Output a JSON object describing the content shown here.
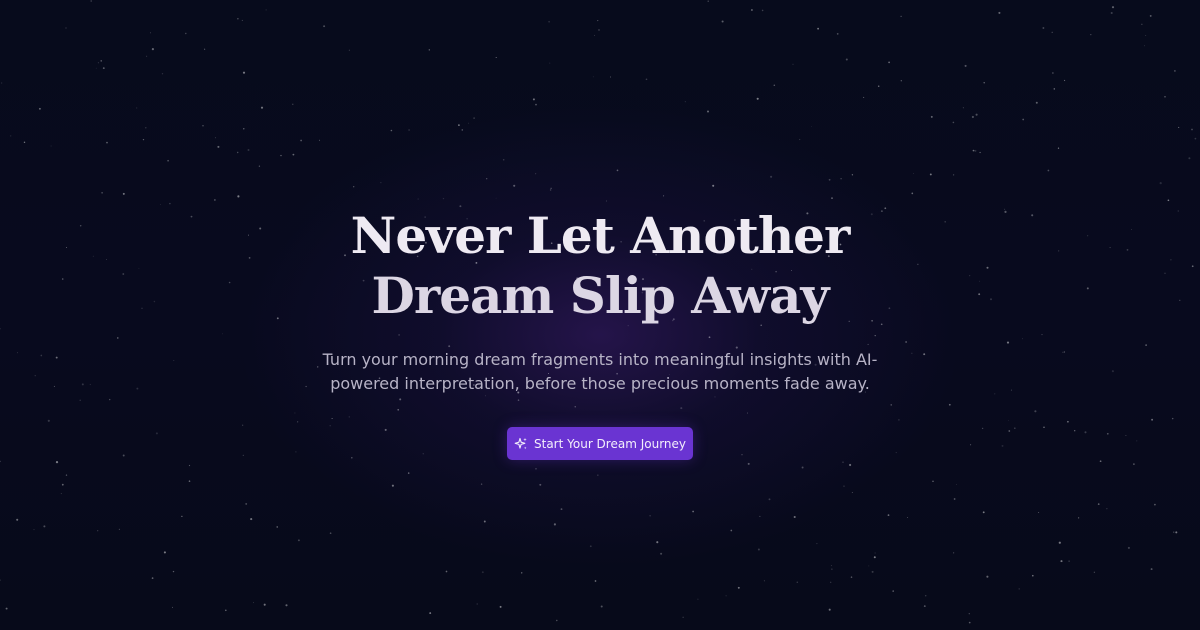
{
  "hero": {
    "title_line1": "Never Let Another",
    "title_line2": "Dream Slip Away",
    "subtitle_line1": "Turn your morning dream fragments into meaningful insights with AI-",
    "subtitle_line2": "powered interpretation, before those precious moments fade away.",
    "cta_label": "Start Your Dream Journey",
    "cta_icon": "sparkles-icon"
  },
  "colors": {
    "background": "#070a1c",
    "glow": "#3c1c6e",
    "title": "#eeeaf2",
    "subtitle": "#b7b3c6",
    "cta_background": "#6a34d2",
    "cta_text": "#f3eefc"
  }
}
